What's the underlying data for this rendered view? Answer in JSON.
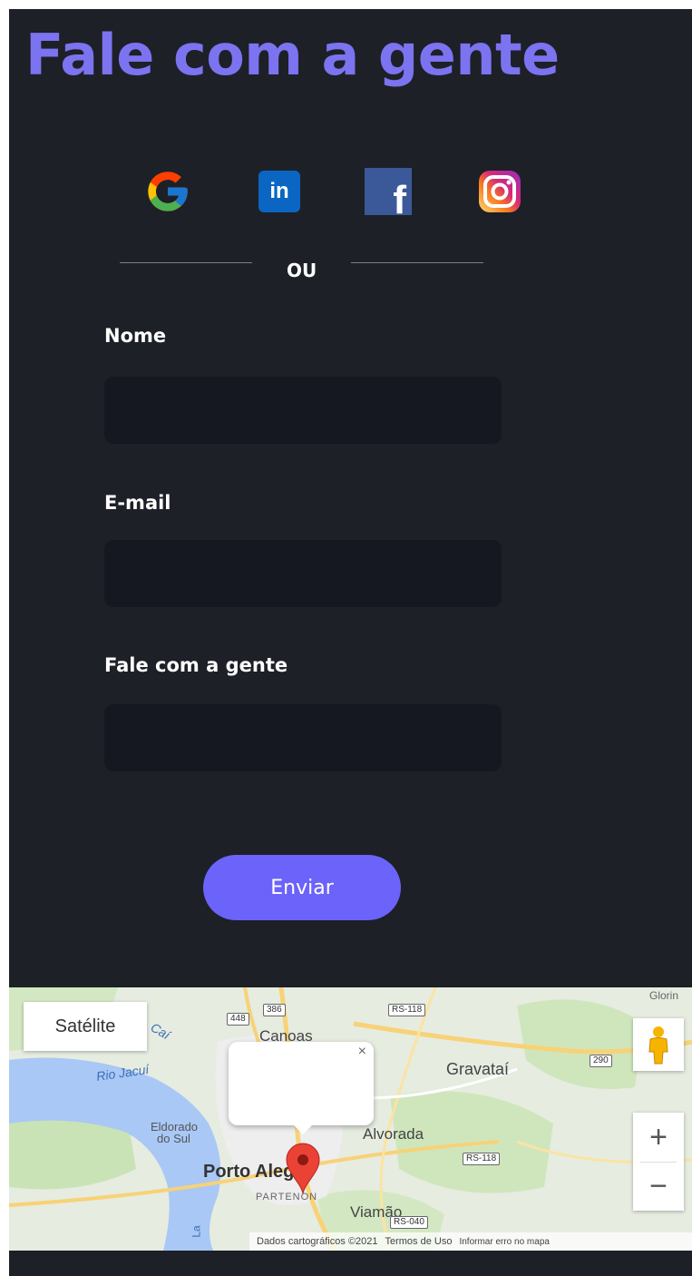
{
  "header": {
    "title": "Fale com a gente"
  },
  "social": {
    "items": [
      {
        "name": "google",
        "icon": "google-icon"
      },
      {
        "name": "linkedin",
        "icon": "linkedin-icon",
        "glyph": "in"
      },
      {
        "name": "facebook",
        "icon": "facebook-icon",
        "glyph": "f"
      },
      {
        "name": "instagram",
        "icon": "instagram-icon"
      }
    ],
    "separator": "OU"
  },
  "form": {
    "name_label": "Nome",
    "name_value": "",
    "email_label": "E-mail",
    "email_value": "",
    "message_label": "Fale com a gente",
    "message_value": "",
    "submit_label": "Enviar"
  },
  "map": {
    "satellite_label": "Satélite",
    "places": {
      "canoas": "Canoas",
      "gravatai": "Gravataí",
      "rio_jacui": "Rio Jacuí",
      "eldorado": "Eldorado",
      "do_sul": "do Sul",
      "alvorada": "Alvorada",
      "porto_alegre": "Porto Alegre",
      "partenon": "PARTENON",
      "viamao": "Viamão",
      "cai": "Caí",
      "gloria": "Glorin",
      "la": "La"
    },
    "road_shields": [
      "448",
      "386",
      "RS-118",
      "290",
      "RS-118",
      "RS-040"
    ],
    "zoom_in": "+",
    "zoom_out": "−",
    "popup_close": "×",
    "footer": {
      "data": "Dados cartográficos ©2021",
      "terms": "Termos de Uso",
      "report": "Informar erro no mapa"
    }
  }
}
